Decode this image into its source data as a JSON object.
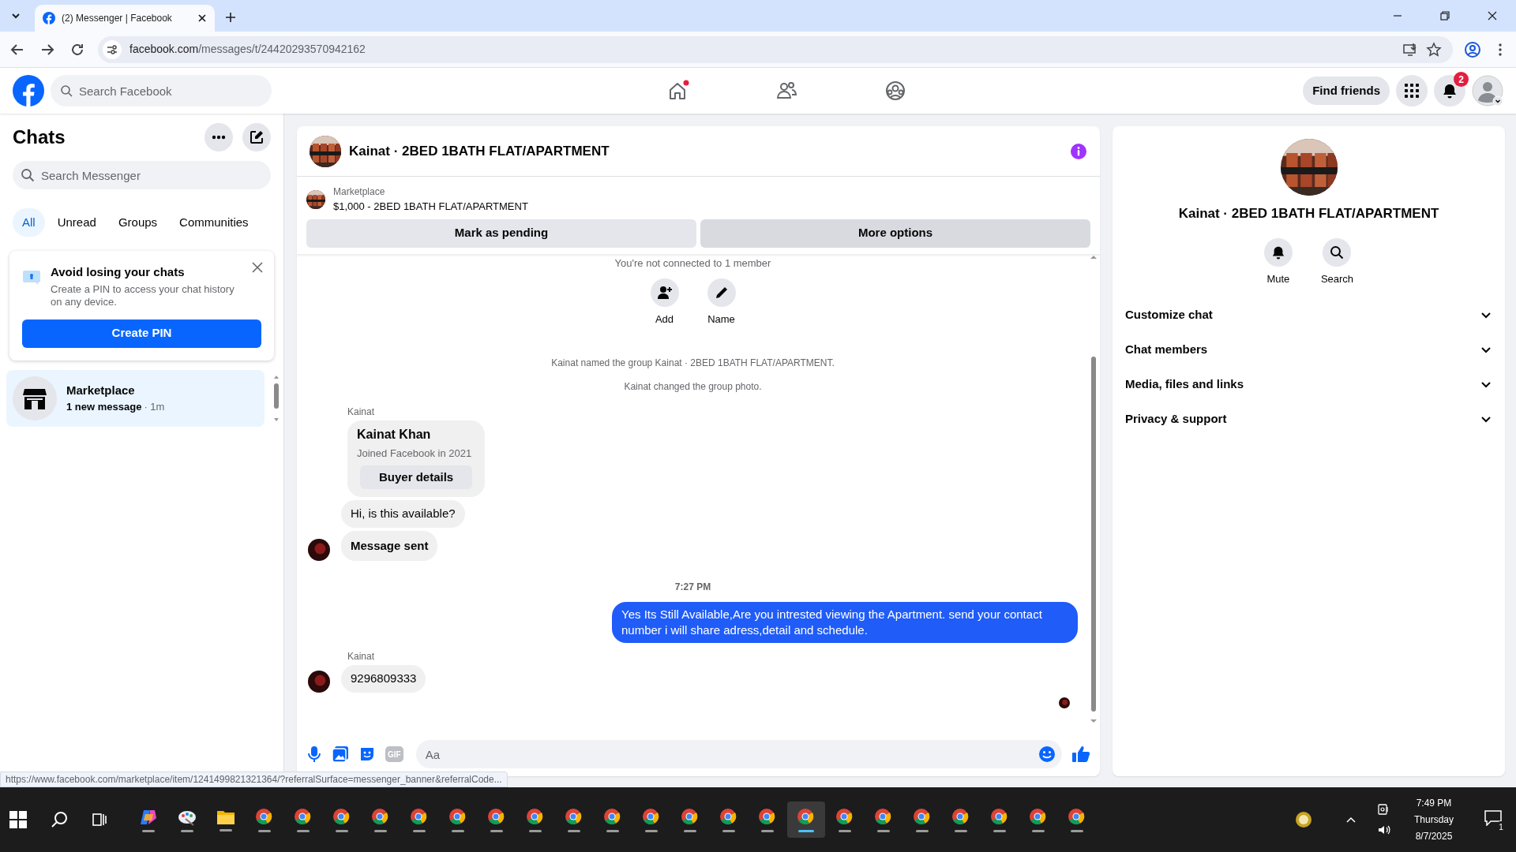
{
  "browser": {
    "tab_title": "(2) Messenger | Facebook",
    "url_host": "facebook.com",
    "url_path": "/messages/t/24420293570942162"
  },
  "header": {
    "search_placeholder": "Search Facebook",
    "home_dot": true,
    "find_friends": "Find friends",
    "notification_count": "2"
  },
  "sidebar": {
    "title": "Chats",
    "search_placeholder": "Search Messenger",
    "tabs": [
      {
        "label": "All",
        "selected": true
      },
      {
        "label": "Unread",
        "selected": false
      },
      {
        "label": "Groups",
        "selected": false
      },
      {
        "label": "Communities",
        "selected": false
      }
    ],
    "pin_card": {
      "title": "Avoid losing your chats",
      "body": "Create a PIN to access your chat history on any device.",
      "button": "Create PIN"
    },
    "chats": [
      {
        "name": "Marketplace",
        "preview": "1 new message",
        "time": "· 1m",
        "selected": true,
        "unread": true
      }
    ]
  },
  "chat": {
    "title": "Kainat · 2BED 1BATH FLAT/APARTMENT",
    "listing_label": "Marketplace",
    "listing_title": "$1,000 - 2BED 1BATH FLAT/APARTMENT",
    "actions": [
      "Mark as pending",
      "More options"
    ],
    "notice": "You're not connected to 1 member",
    "quick_actions": [
      {
        "kind": "add",
        "label": "Add"
      },
      {
        "kind": "name",
        "label": "Name"
      }
    ],
    "messages": [
      {
        "kind": "system",
        "text": "Kainat named the group Kainat · 2BED 1BATH FLAT/APARTMENT."
      },
      {
        "kind": "system",
        "text": "Kainat changed the group photo."
      },
      {
        "kind": "sender",
        "text": "Kainat"
      },
      {
        "kind": "profile_card",
        "name": "Kainat Khan",
        "detail": "Joined Facebook in 2021",
        "button": "Buyer details"
      },
      {
        "kind": "incoming",
        "text": "Hi, is this available?",
        "avatar": false
      },
      {
        "kind": "incoming_bold",
        "text": "Message sent",
        "avatar": true
      },
      {
        "kind": "time",
        "text": "7:27 PM"
      },
      {
        "kind": "outgoing",
        "text": "Yes Its Still Available,Are you intrested viewing the Apartment. send your contact number i will share adress,detail and schedule."
      },
      {
        "kind": "sender",
        "text": "Kainat"
      },
      {
        "kind": "incoming",
        "text": "9296809333",
        "avatar": true
      }
    ],
    "gif_label": "GIF",
    "composer_placeholder": "Aa"
  },
  "details": {
    "title": "Kainat · 2BED 1BATH FLAT/APARTMENT",
    "actions": [
      {
        "kind": "mute",
        "label": "Mute"
      },
      {
        "kind": "search",
        "label": "Search"
      }
    ],
    "sections": [
      {
        "label": "Customize chat",
        "expanded": false
      },
      {
        "label": "Chat members",
        "expanded": false
      },
      {
        "label": "Media, files and links",
        "expanded": false
      },
      {
        "label": "Privacy & support",
        "expanded": false
      }
    ]
  },
  "status_url": "https://www.facebook.com/marketplace/item/1241499821321364/?referralSurface=messenger_banner&referralCode...",
  "taskbar": {
    "apps": [
      {
        "kind": "copilot",
        "selected": false
      },
      {
        "kind": "paint",
        "selected": false
      },
      {
        "kind": "folder",
        "selected": false
      },
      {
        "kind": "chrome",
        "selected": false
      },
      {
        "kind": "chrome",
        "selected": false
      },
      {
        "kind": "chrome",
        "selected": false
      },
      {
        "kind": "chrome",
        "selected": false
      },
      {
        "kind": "chrome",
        "selected": false
      },
      {
        "kind": "chrome",
        "selected": false
      },
      {
        "kind": "chrome",
        "selected": false
      },
      {
        "kind": "chrome",
        "selected": false
      },
      {
        "kind": "chrome",
        "selected": false
      },
      {
        "kind": "chrome",
        "selected": false
      },
      {
        "kind": "chrome",
        "selected": false
      },
      {
        "kind": "chrome",
        "selected": false
      },
      {
        "kind": "chrome",
        "selected": false
      },
      {
        "kind": "chrome",
        "selected": false
      },
      {
        "kind": "chrome",
        "selected": true
      },
      {
        "kind": "chrome",
        "selected": false
      },
      {
        "kind": "chrome",
        "selected": false
      },
      {
        "kind": "chrome",
        "selected": false
      },
      {
        "kind": "chrome",
        "selected": false
      },
      {
        "kind": "chrome",
        "selected": false
      },
      {
        "kind": "chrome",
        "selected": false
      },
      {
        "kind": "chrome",
        "selected": false
      }
    ],
    "time": "7:49 PM",
    "day": "Thursday",
    "date": "8/7/2025",
    "notifications": "1"
  }
}
